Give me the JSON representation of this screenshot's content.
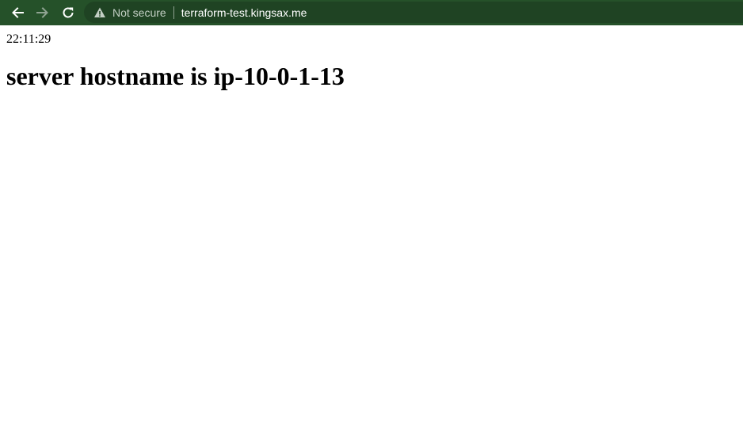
{
  "browser": {
    "security_label": "Not secure",
    "url": "terraform-test.kingsax.me",
    "icons": {
      "back": "back-arrow-icon",
      "forward": "forward-arrow-icon",
      "reload": "reload-icon",
      "security": "warning-triangle-icon"
    },
    "colors": {
      "toolbar": "#255129",
      "omnibox": "#1f4323"
    }
  },
  "page": {
    "time": "22:11:29",
    "heading": "server hostname is ip-10-0-1-13"
  }
}
